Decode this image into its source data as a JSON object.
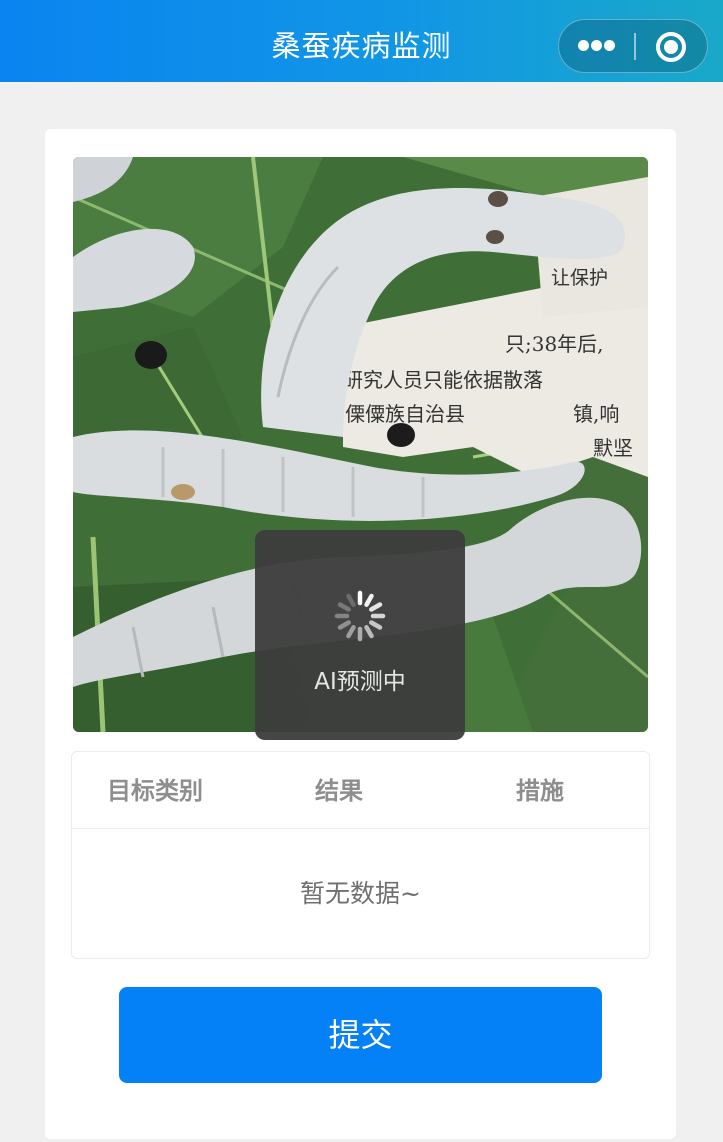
{
  "nav": {
    "title": "桑蚕疾病监测",
    "more_icon": "more-dots-icon",
    "close_icon": "capsule-close-icon"
  },
  "image": {
    "content": "silkworm-photo",
    "printed_text": [
      "让保护",
      "只;38年后,",
      "研究人员只能依据散落",
      "傈僳族自治县",
      "镇,响",
      "默坚"
    ]
  },
  "toast": {
    "icon": "loading-spinner-icon",
    "text": "AI预测中"
  },
  "table": {
    "headers": [
      "目标类别",
      "结果",
      "措施"
    ],
    "empty_text": "暂无数据~"
  },
  "submit_label": "提交",
  "colors": {
    "nav_gradient_start": "#0a84f0",
    "nav_gradient_end": "#19a9c8",
    "button": "#0581f8",
    "background": "#f0f0f0"
  }
}
